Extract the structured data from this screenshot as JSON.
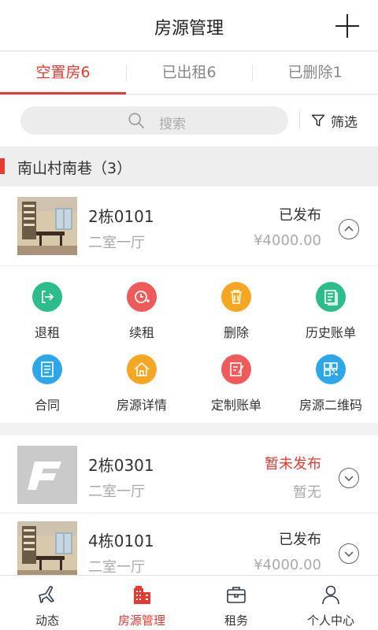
{
  "header": {
    "title": "房源管理"
  },
  "tabs": [
    {
      "label": "空置房6",
      "active": true
    },
    {
      "label": "已出租6",
      "active": false
    },
    {
      "label": "已删除1",
      "active": false
    }
  ],
  "search": {
    "placeholder": "搜索",
    "filter_label": "筛选"
  },
  "group": {
    "title": "南山村南巷（3）"
  },
  "rooms": [
    {
      "name": "2栋0101",
      "layout": "二室一厅",
      "status": "已发布",
      "rent": "¥4000.00",
      "expanded": true,
      "thumb": "photo"
    },
    {
      "name": "2栋0301",
      "layout": "二室一厅",
      "status": "暂未发布",
      "rent": "暂无",
      "expanded": false,
      "thumb": "placeholder"
    },
    {
      "name": "4栋0101",
      "layout": "二室一厅",
      "status": "已发布",
      "rent": "¥4000.00",
      "expanded": false,
      "thumb": "photo"
    }
  ],
  "actions": [
    {
      "label": "退租",
      "icon": "checkout-icon",
      "color": "#2dbd8a"
    },
    {
      "label": "续租",
      "icon": "renew-icon",
      "color": "#f05a5a"
    },
    {
      "label": "删除",
      "icon": "trash-icon",
      "color": "#f5a623"
    },
    {
      "label": "历史账单",
      "icon": "history-bill-icon",
      "color": "#2dbd8a"
    },
    {
      "label": "合同",
      "icon": "contract-icon",
      "color": "#2ea7e8"
    },
    {
      "label": "房源详情",
      "icon": "house-detail-icon",
      "color": "#f5a623"
    },
    {
      "label": "定制账单",
      "icon": "custom-bill-icon",
      "color": "#f05a5a"
    },
    {
      "label": "房源二维码",
      "icon": "qrcode-icon",
      "color": "#2ea7e8"
    }
  ],
  "bottom_nav": [
    {
      "label": "动态",
      "icon": "plane-icon",
      "active": false
    },
    {
      "label": "房源管理",
      "icon": "building-icon",
      "active": true
    },
    {
      "label": "租务",
      "icon": "briefcase-icon",
      "active": false
    },
    {
      "label": "个人中心",
      "icon": "person-icon",
      "active": false
    }
  ],
  "colors": {
    "accent": "#e63b32",
    "muted": "#aaaaaa"
  }
}
